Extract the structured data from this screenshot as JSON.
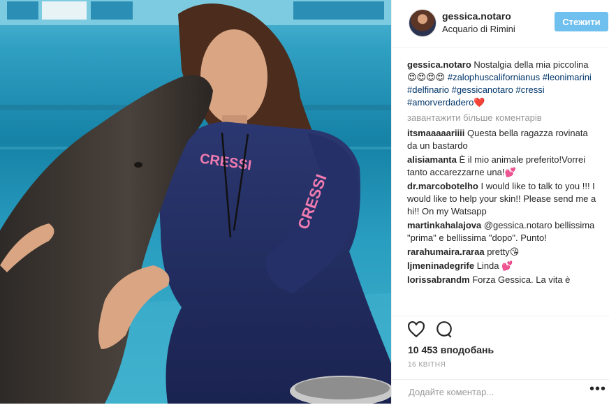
{
  "post": {
    "username": "gessica.notaro",
    "location": "Acquario di Rimini",
    "follow_label": "Стежити"
  },
  "caption": {
    "username": "gessica.notaro",
    "text": "Nostalgia della mia piccolina 😍😍😍😍",
    "hashtags": [
      "#zalophuscalifornianus",
      "#leonimarini",
      "#delfinario",
      "#gessicanotaro",
      "#cressi",
      "#amorverdadero❤️"
    ]
  },
  "load_more_label": "завантажити більше коментарів",
  "comments": [
    {
      "user": "itsmaaaaariiii",
      "text": "Questa bella ragazza rovinata da un bastardo"
    },
    {
      "user": "alisiamanta",
      "text": "È il mio animale preferito!Vorrei tanto accarezzarne una!💕"
    },
    {
      "user": "dr.marcobotelho",
      "text": "I would like to talk to you !!! I would like to help your skin!! Please send me a hi!! On my Watsapp"
    },
    {
      "user": "martinkahalajova",
      "text": "@gessica.notaro bellissima \"prima\" e bellissima \"dopo\". Punto!"
    },
    {
      "user": "rarahumaira.raraa",
      "text": "pretty😘"
    },
    {
      "user": "ljmeninadegrife",
      "text": "Linda 💕"
    },
    {
      "user": "lorissabrandm",
      "text": "Forza Gessica. La vita è"
    }
  ],
  "likes": "10 453 вподобань",
  "date": "16 КВІТНЯ",
  "comment_placeholder": "Додайте коментар...",
  "more_options": "•••",
  "photo": {
    "suit_brand": "CRESSI",
    "colors": {
      "water": "#2a96b8",
      "wetsuit": "#1f2a55",
      "accent": "#e64a8c"
    }
  }
}
